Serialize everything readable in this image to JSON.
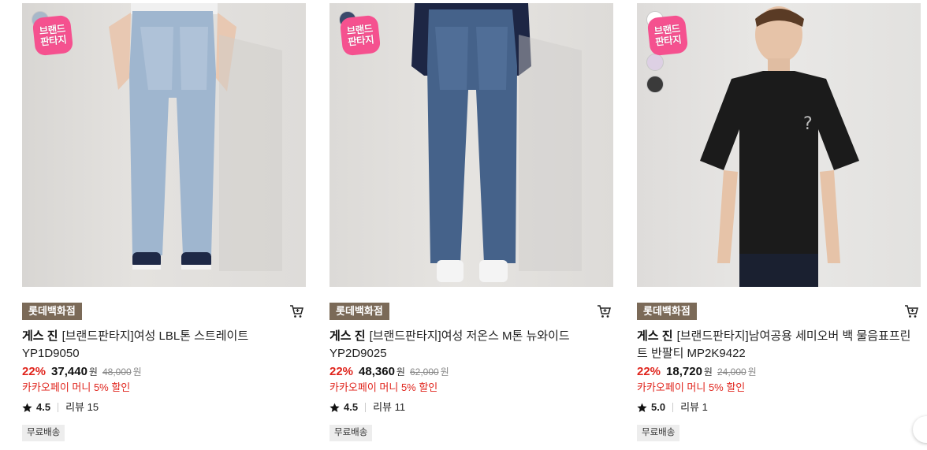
{
  "products": [
    {
      "badge": "브랜드판타지",
      "swatches": [
        "#a8b8c9"
      ],
      "store": "롯데백화점",
      "brand": "게스 진",
      "name": "[브랜드판타지]여성 LBL톤 스트레이트 YP1D9050",
      "discount": "22%",
      "sale_price": "37,440",
      "currency": "원",
      "original_price": "48,000",
      "promo": "카카오페이 머니 5% 할인",
      "rating": "4.5",
      "review": "리뷰 15",
      "shipping": "무료배송",
      "image": "light-wash-straight-jeans"
    },
    {
      "badge": "브랜드판타지",
      "swatches": [
        "#3b4a6b"
      ],
      "store": "롯데백화점",
      "brand": "게스 진",
      "name": "[브랜드판타지]여성 저온스 M톤 뉴와이드 YP2D9025",
      "discount": "22%",
      "sale_price": "48,360",
      "currency": "원",
      "original_price": "62,000",
      "promo": "카카오페이 머니 5% 할인",
      "rating": "4.5",
      "review": "리뷰 11",
      "shipping": "무료배송",
      "image": "mid-wash-wide-jeans"
    },
    {
      "badge": "브랜드판타지",
      "swatches": [
        "#ffffff",
        "#ddd0e4",
        "#3a3a3a"
      ],
      "store": "롯데백화점",
      "brand": "게스 진",
      "name": "[브랜드판타지]남여공용 세미오버 백 물음표프린트 반팔티 MP2K9422",
      "discount": "22%",
      "sale_price": "18,720",
      "currency": "원",
      "original_price": "24,000",
      "promo": "카카오페이 머니 5% 할인",
      "rating": "5.0",
      "review": "리뷰 1",
      "shipping": "무료배송",
      "image": "black-tshirt"
    }
  ],
  "colors": {
    "accent_red": "#e0241c",
    "store_tag": "#7b6a58",
    "badge_pink": "#f5518f"
  }
}
